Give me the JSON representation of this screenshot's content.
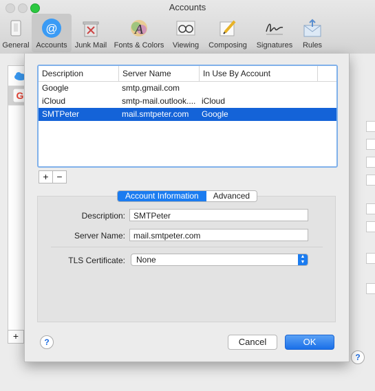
{
  "window": {
    "title": "Accounts"
  },
  "toolbar": {
    "items": [
      {
        "label": "General",
        "icon": "general-icon"
      },
      {
        "label": "Accounts",
        "icon": "at-sign-icon",
        "active": true
      },
      {
        "label": "Junk Mail",
        "icon": "trash-icon"
      },
      {
        "label": "Fonts & Colors",
        "icon": "fonts-icon"
      },
      {
        "label": "Viewing",
        "icon": "glasses-icon"
      },
      {
        "label": "Composing",
        "icon": "pencil-icon"
      },
      {
        "label": "Signatures",
        "icon": "signature-icon"
      },
      {
        "label": "Rules",
        "icon": "envelope-icon"
      }
    ]
  },
  "smtp_table": {
    "columns": [
      "Description",
      "Server Name",
      "In Use By Account"
    ],
    "rows": [
      {
        "description": "Google",
        "server": "smtp.gmail.com",
        "account": ""
      },
      {
        "description": "iCloud",
        "server": "smtp-mail.outlook....",
        "account": "iCloud"
      },
      {
        "description": "SMTPeter",
        "server": "mail.smtpeter.com",
        "account": "Google"
      }
    ],
    "selected_index": 2
  },
  "list_buttons": {
    "add": "+",
    "remove": "−"
  },
  "tabs": {
    "account_info": "Account Information",
    "advanced": "Advanced"
  },
  "form": {
    "description_label": "Description:",
    "description_value": "SMTPeter",
    "server_name_label": "Server Name:",
    "server_name_value": "mail.smtpeter.com",
    "tls_label": "TLS Certificate:",
    "tls_value": "None"
  },
  "buttons": {
    "help": "?",
    "cancel": "Cancel",
    "ok": "OK"
  },
  "background": {
    "add": "+",
    "help": "?"
  },
  "colors": {
    "accent": "#1b7cf0",
    "selection": "#1463d8"
  }
}
